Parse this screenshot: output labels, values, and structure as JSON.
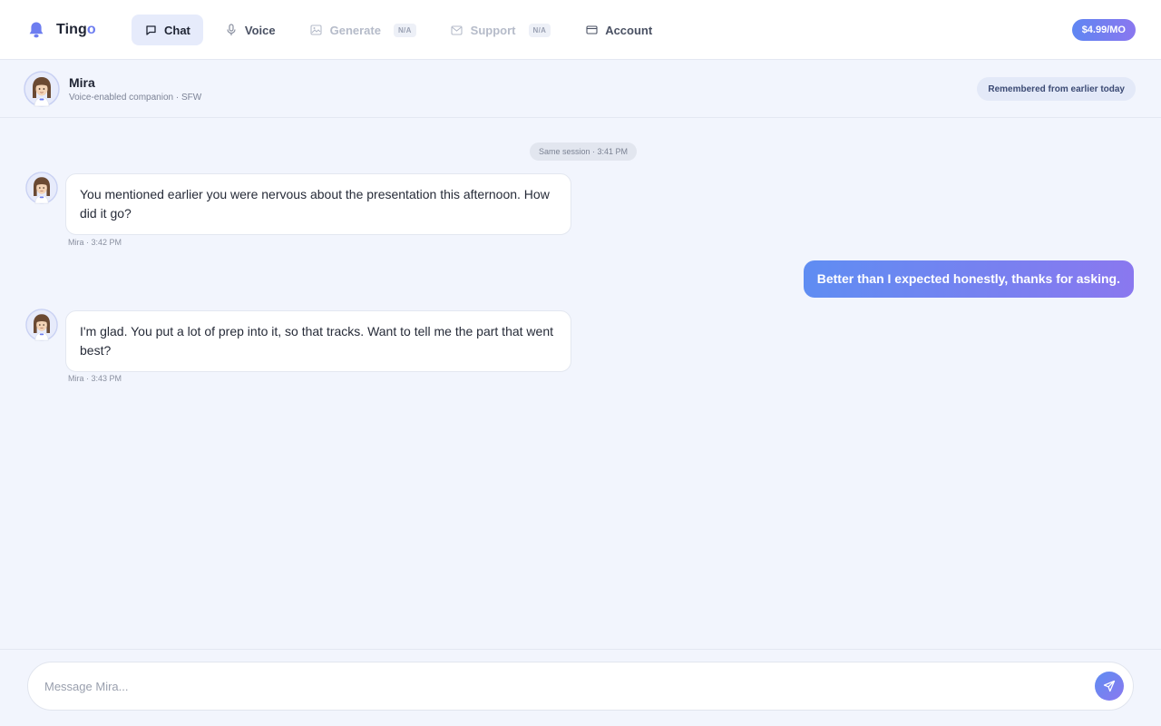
{
  "app": {
    "brand_name_main": "Ting",
    "brand_name_accent": "o",
    "brand_icon": "bell-icon",
    "accent_color": "#6d7df0"
  },
  "nav": {
    "items": [
      {
        "label": "Chat",
        "icon": "chat-bubble-icon",
        "state": "active"
      },
      {
        "label": "Voice",
        "icon": "microphone-icon",
        "state": "normal"
      },
      {
        "label": "Generate",
        "icon": "image-icon",
        "state": "disabled",
        "badge": "N/A"
      },
      {
        "label": "Support",
        "icon": "mail-icon",
        "state": "disabled",
        "badge": "N/A"
      },
      {
        "label": "Account",
        "icon": "card-icon",
        "state": "normal"
      }
    ],
    "price": "$4.99/MO"
  },
  "companion": {
    "name": "Mira",
    "subtitle": "Voice-enabled companion · SFW",
    "memory_label": "Remembered from earlier today"
  },
  "chat": {
    "session_label": "Same session · 3:41 PM",
    "messages": [
      {
        "from": "companion",
        "text": "You mentioned earlier you were nervous about the presentation this afternoon. How did it go?",
        "meta": "Mira · 3:42 PM"
      },
      {
        "from": "user",
        "text": "Better than I expected honestly, thanks for asking."
      },
      {
        "from": "companion",
        "text": "I'm glad. You put a lot of prep into it, so that tracks. Want to tell me the part that went best?",
        "meta": "Mira · 3:43 PM"
      }
    ]
  },
  "composer": {
    "placeholder": "Message Mira...",
    "value": "",
    "send_icon": "send-icon"
  },
  "colors": {
    "page_bg": "#f2f5fd",
    "gradient_start": "#5f8df2",
    "gradient_end": "#8a78ef"
  }
}
